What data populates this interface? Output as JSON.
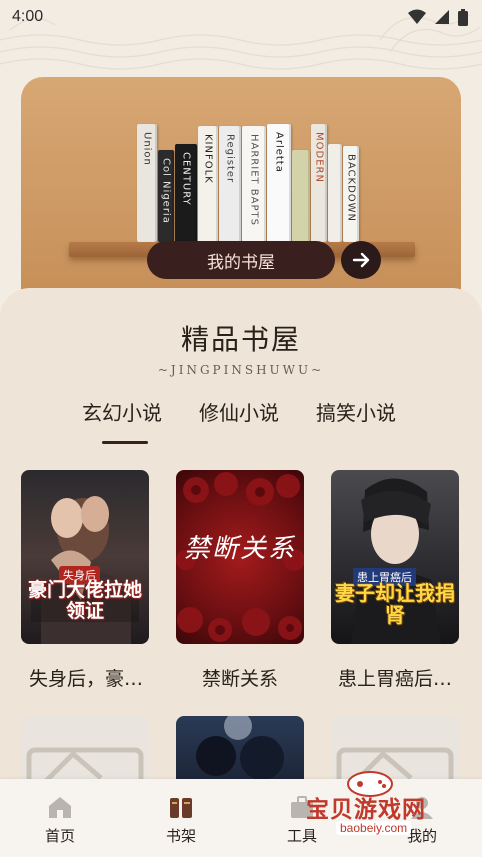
{
  "status_bar": {
    "time": "4:00"
  },
  "hero": {
    "books": [
      {
        "title": "Union",
        "color": "#e9e6df",
        "text": "#333"
      },
      {
        "title": "Col Nigeria",
        "color": "#2b2b2b",
        "text": "#e6e6e6"
      },
      {
        "title": "CENTURY",
        "color": "#1b1b1b",
        "text": "#f2f2f2"
      },
      {
        "title": "KINFOLK",
        "color": "#f4f1ea",
        "text": "#222"
      },
      {
        "title": "Register",
        "color": "#ececec",
        "text": "#444"
      },
      {
        "title": "HARRIET BAPTS",
        "color": "#f7f6f3",
        "text": "#555"
      },
      {
        "title": "Arletta",
        "color": "#fafafa",
        "text": "#1e1e1e"
      },
      {
        "title": "",
        "color": "#d4d2a8",
        "text": "#333"
      },
      {
        "title": "MODERN",
        "color": "#ebe7df",
        "text": "#b14b2c"
      },
      {
        "title": "",
        "color": "#f1eee7",
        "text": "#333"
      },
      {
        "title": "BACKDOWN",
        "color": "#f6f4ef",
        "text": "#333"
      }
    ],
    "my_books_label": "我的书屋"
  },
  "section": {
    "title": "精品书屋",
    "subtitle": "~JINGPINSHUWU~"
  },
  "tabs": [
    {
      "label": "玄幻小说",
      "active": true
    },
    {
      "label": "修仙小说",
      "active": false
    },
    {
      "label": "搞笑小说",
      "active": false
    }
  ],
  "books": [
    {
      "name": "失身后，豪…",
      "cover_title": "豪门大佬拉她领证",
      "cover_tag": "失身后"
    },
    {
      "name": "禁断关系",
      "cover_title": "禁断关系",
      "cover_tag": ""
    },
    {
      "name": "患上胃癌后…",
      "cover_title": "妻子却让我捐肾",
      "cover_tag": "患上胃癌后"
    }
  ],
  "nav": [
    {
      "label": "首页",
      "icon": "home-icon",
      "active": false
    },
    {
      "label": "书架",
      "icon": "books-icon",
      "active": true
    },
    {
      "label": "工具",
      "icon": "toolbox-icon",
      "active": false
    },
    {
      "label": "我的",
      "icon": "profile-icon",
      "active": false
    }
  ],
  "watermark": {
    "text": "宝贝游戏网",
    "domain": "baobeiy.com"
  },
  "colors": {
    "accent": "#3a1f1f",
    "hero": "#c99460",
    "panel": "#eee5d8"
  }
}
